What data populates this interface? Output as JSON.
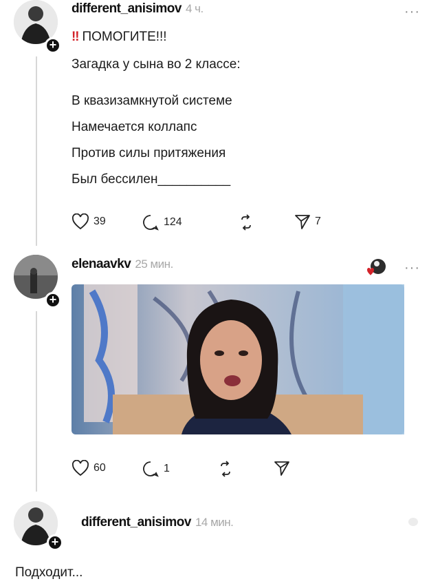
{
  "posts": [
    {
      "username": "different_anisimov",
      "time": "4 ч.",
      "more": "···",
      "headline_mark": "‼",
      "headline": "ПОМОГИТЕ!!!",
      "intro": "Загадка у сына во 2 классе:",
      "riddle": [
        "В квазизамкнутой системе",
        "Намечается коллапс",
        "Против силы притяжения",
        "Был бессилен__________"
      ],
      "likes": "39",
      "comments": "124",
      "shares": "7"
    },
    {
      "username": "elenaavkv",
      "time": "25 мин.",
      "more": "···",
      "likes": "60",
      "comments": "1"
    },
    {
      "username": "different_anisimov",
      "time": "14 мин.",
      "text": "Подходит..."
    }
  ],
  "icons": [
    "heart-icon",
    "comment-icon",
    "repost-icon",
    "share-icon",
    "plus-icon"
  ]
}
